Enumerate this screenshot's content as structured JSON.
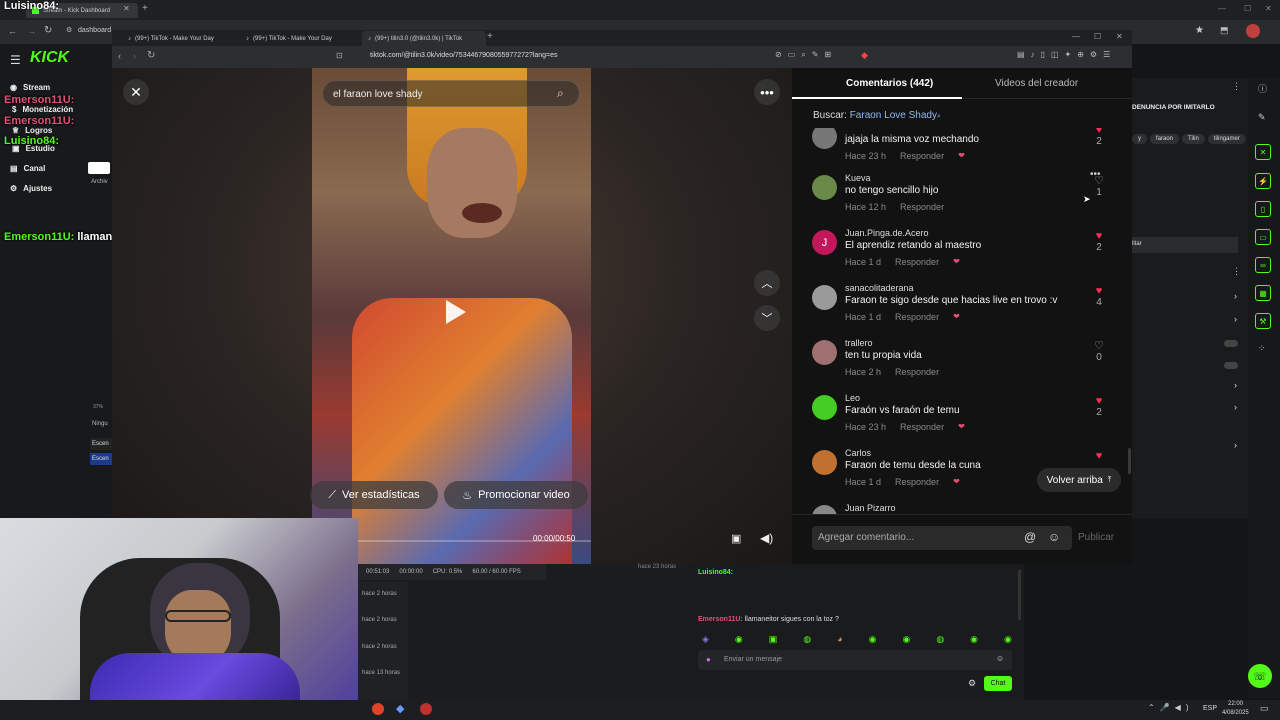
{
  "outer_browser": {
    "window_label": "Luisino84:",
    "tabs": [
      {
        "label": "Stream - Kick Dashboard"
      },
      {
        "label": "(99+) TikTok - Make Your Day"
      },
      {
        "label": "(99+) TikTok - Make Your Day"
      },
      {
        "label": "(99+) tilin3.0 (@tilin3.0k) | TikTok"
      }
    ],
    "kick_url": "dashboard"
  },
  "kick": {
    "logo": "KICK",
    "nav": [
      {
        "label": "Stream",
        "icon": "broadcast-icon"
      },
      {
        "label": "Monetización",
        "icon": "money-icon"
      },
      {
        "label": "Logros",
        "icon": "trophy-icon"
      },
      {
        "label": "Estudio",
        "icon": "studio-icon"
      },
      {
        "label": "Canal",
        "icon": "channel-icon"
      },
      {
        "label": "Ajustes",
        "icon": "gear-icon"
      }
    ],
    "partial_labels": {
      "archiv": "Archiv",
      "ningu": "Ningu",
      "escen1": "Escen",
      "escen2": "Escen",
      "pct": "37%"
    },
    "right_panel": {
      "title": "DENUNCIA POR IMITARLO",
      "tags": [
        "y",
        "faraon",
        "Tilin",
        "tilingamer"
      ],
      "button": "litar"
    }
  },
  "overlay_chat": [
    {
      "user": "Emerson11U:",
      "color": "pink"
    },
    {
      "user": "Emerson11U:",
      "color": "pink"
    },
    {
      "user": "Luisino84:",
      "color": "green"
    },
    {
      "user": "Emerson11U:",
      "message": "llamaneitor sigues con la toz ?",
      "color": "green"
    }
  ],
  "tiktok": {
    "url": "tiktok.com/@tilin3.0k/video/7534467908055977272?lang=es",
    "search_value": "el faraon love shady",
    "stats_button": "Ver estadísticas",
    "promote_button": "Promocionar video",
    "time": "00:00/00:50",
    "tabs": {
      "comments": "Comentarios (442)",
      "creator_videos": "Videos del creador"
    },
    "search_label": "Buscar:",
    "search_link": "Faraon Love Shady",
    "reply_label": "Responder",
    "comments": [
      {
        "name": "",
        "text": "jajaja la misma voz mechando",
        "time": "Hace 23 h",
        "likes": "2",
        "liked": true,
        "creator_liked": true,
        "avatar": "#777777"
      },
      {
        "name": "Kueva",
        "text": "no tengo sencillo hijo",
        "time": "Hace 12 h",
        "likes": "1",
        "liked": false,
        "creator_liked": false,
        "avatar": "#6a8a4a"
      },
      {
        "name": "Juan.Pinga.de.Acero",
        "text": "El aprendiz retando al maestro",
        "time": "Hace 1 d",
        "likes": "2",
        "liked": true,
        "creator_liked": true,
        "avatar": "#c2185b",
        "initial": "J"
      },
      {
        "name": "sanacolitaderana",
        "text": "Faraon te sigo desde que hacias live en trovo :v",
        "time": "Hace 1 d",
        "likes": "4",
        "liked": true,
        "creator_liked": true,
        "avatar": "#9a9a9a"
      },
      {
        "name": "trallero",
        "text": "ten tu propia vida",
        "time": "Hace 2 h",
        "likes": "0",
        "liked": false,
        "creator_liked": false,
        "avatar": "#a07070"
      },
      {
        "name": "Leo",
        "text": "Faraón vs faraón de temu",
        "time": "Hace 23 h",
        "likes": "2",
        "liked": true,
        "creator_liked": true,
        "avatar": "#44cc22"
      },
      {
        "name": "Carlos",
        "text": "Faraon de temu desde la cuna",
        "time": "Hace 1 d",
        "likes": "",
        "liked": true,
        "creator_liked": true,
        "avatar": "#c07030"
      },
      {
        "name": "Juan Pizarro",
        "text": "",
        "time": "",
        "likes": "",
        "liked": false,
        "creator_liked": false,
        "avatar": "#888888"
      }
    ],
    "back_to_top": "Volver arriba",
    "comment_placeholder": "Agregar comentario...",
    "publish": "Publicar"
  },
  "obs": {
    "time1": "00:51:03",
    "time2": "00:00:00",
    "cpu": "CPU: 0.5%",
    "fps": "60.00 / 60.00 FPS",
    "hace23": "hace 23 horas",
    "rows": [
      "hace 2 horas",
      "hace 2 horas",
      "hace 2 horas",
      "hace 13 horas"
    ]
  },
  "kick_chat": {
    "top_user": "Luisino84:",
    "line_user": "Emerson11U:",
    "line_msg": "llamaneitor sigues con la toz ?",
    "input_placeholder": "Enviar un mensaje",
    "chat_button": "Chat"
  },
  "taskbar": {
    "lang": "ESP",
    "time": "22:00",
    "date": "4/08/2025"
  }
}
